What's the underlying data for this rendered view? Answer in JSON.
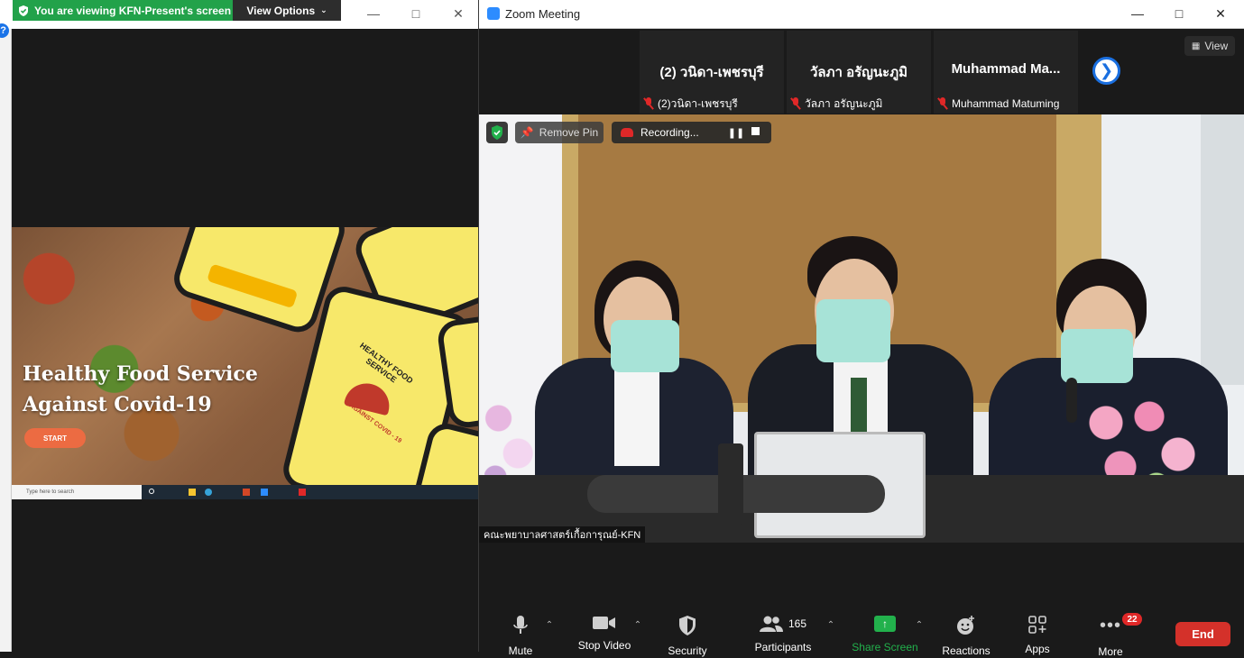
{
  "share_viewer": {
    "banner_text": "You are viewing KFN-Present's screen",
    "view_options_label": "View Options",
    "window_controls": [
      "minimize",
      "maximize",
      "close"
    ],
    "help_icon_text": "?"
  },
  "shared_slide": {
    "title_line1": "Healthy Food Service",
    "title_line2": "Against Covid-19",
    "start_button": "START",
    "phone_brand": "HEALTHY FOOD SERVICE",
    "phone_tagline": "AGAINST COVID - 19",
    "taskbar_search_placeholder": "Type here to search"
  },
  "zoom": {
    "window_title": "Zoom Meeting",
    "view_button": "View",
    "participants_tiles": [
      {
        "display_name": "(2) วนิดา-เพชรบุรี",
        "label": "(2)วนิดา-เพชรบุรี",
        "muted": true
      },
      {
        "display_name": "วัลภา อรัญนะภูมิ",
        "label": "วัลภา อรัญนะภูมิ",
        "muted": true
      },
      {
        "display_name": "Muhammad  Ma...",
        "label": "Muhammad Matuming",
        "muted": true
      }
    ],
    "overlay": {
      "remove_pin": "Remove Pin",
      "recording": "Recording..."
    },
    "speaker_label": "คณะพยาบาลศาสตร์เกื้อการุณย์-KFN",
    "toolbar": {
      "mute": "Mute",
      "stop_video": "Stop Video",
      "security": "Security",
      "participants": "Participants",
      "participants_count": "165",
      "share_screen": "Share Screen",
      "reactions": "Reactions",
      "apps": "Apps",
      "more": "More",
      "more_badge": "22",
      "end": "End"
    },
    "colors": {
      "share_green": "#22b14c",
      "end_red": "#d4312a",
      "muted_red": "#e02828",
      "accent_blue": "#2d8cff"
    }
  }
}
